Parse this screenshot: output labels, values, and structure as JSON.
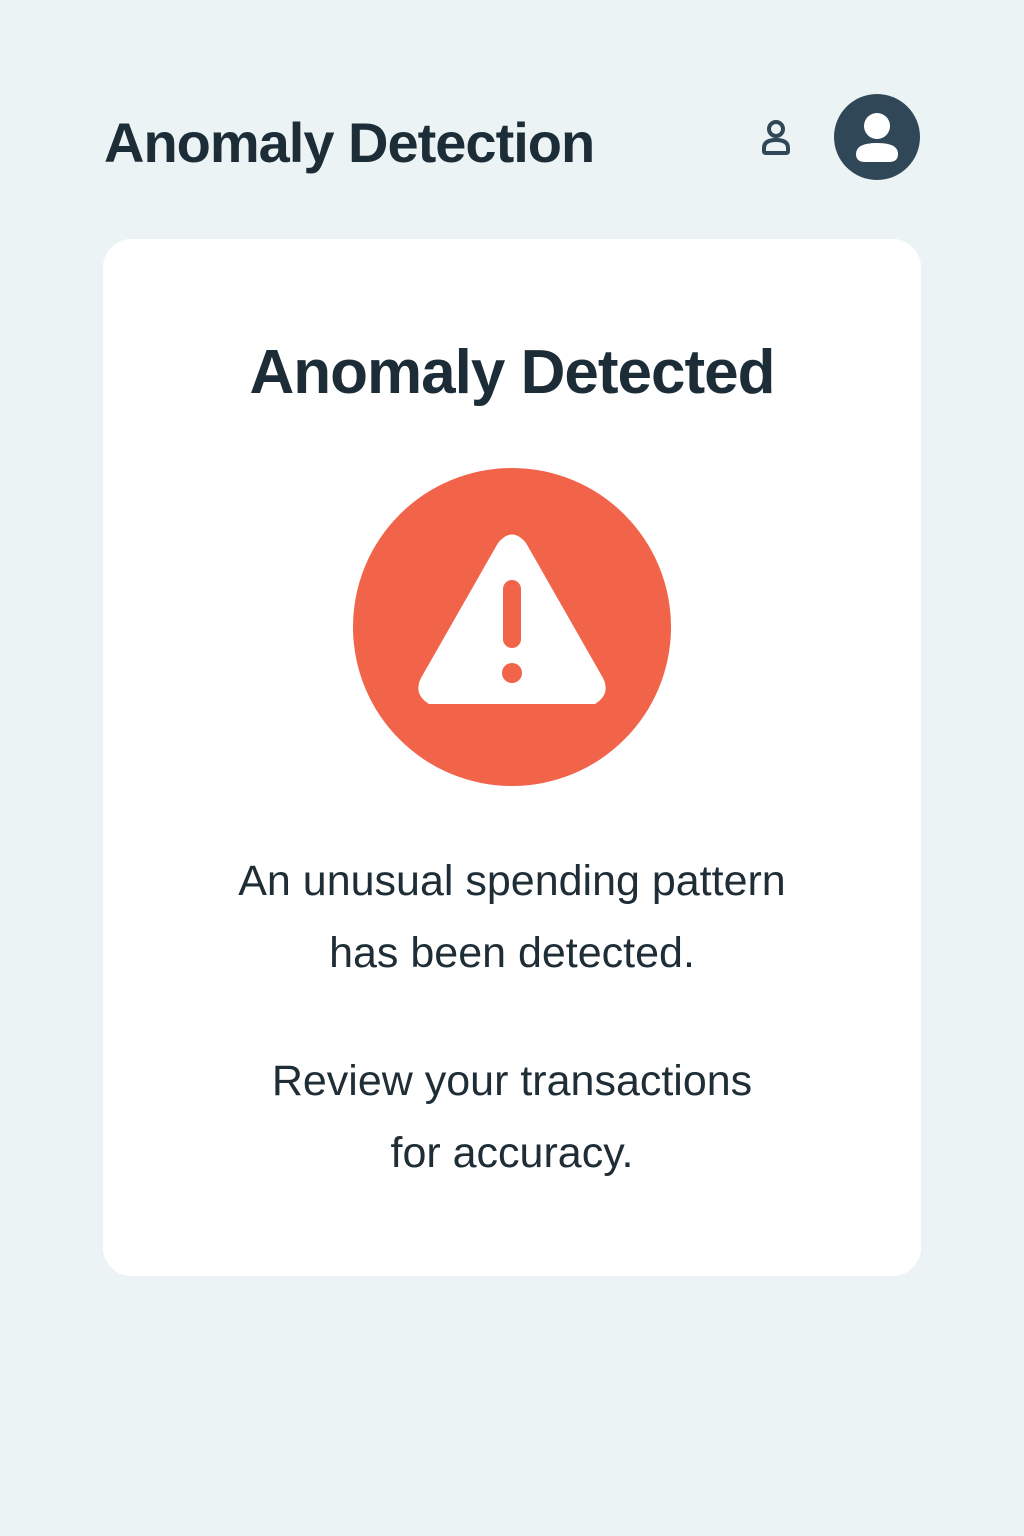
{
  "header": {
    "title": "Anomaly Detection",
    "profile_icon": "user-outline-icon",
    "avatar_icon": "user-avatar-icon"
  },
  "alert": {
    "title": "Anomaly Detected",
    "icon": "warning-triangle-icon",
    "message_lines": [
      "An unusual spending pattern",
      "has been detected."
    ],
    "instruction_lines": [
      "Review your transactions",
      "for accuracy."
    ]
  },
  "colors": {
    "background": "#ebf3f5",
    "card": "#ffffff",
    "text": "#1c2d38",
    "warning": "#f2644a",
    "avatar": "#2f4756"
  }
}
